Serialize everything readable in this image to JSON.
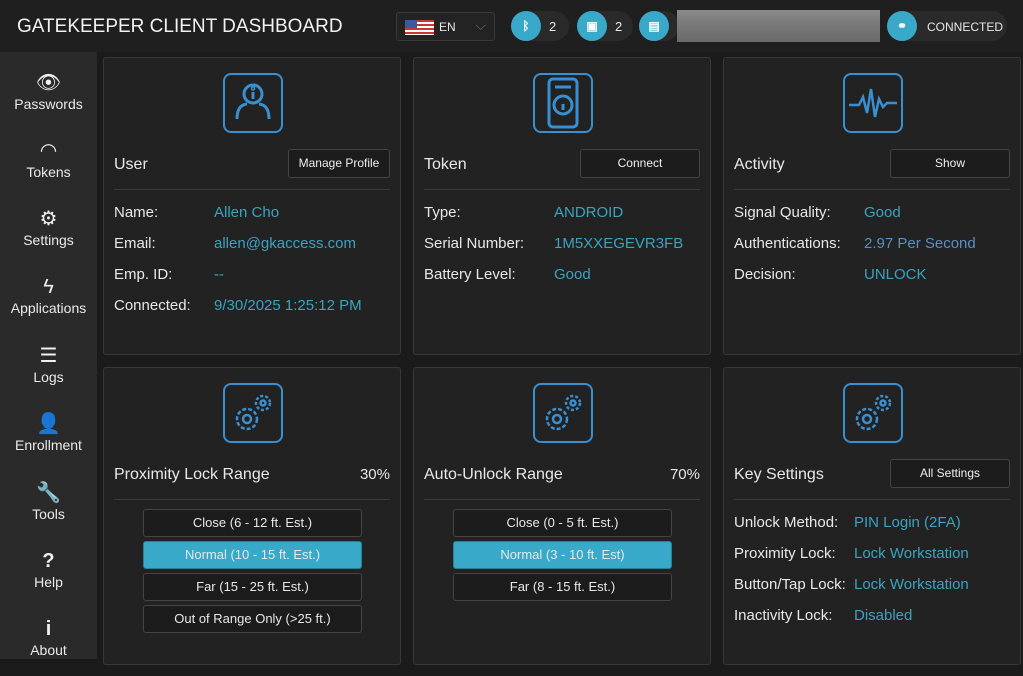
{
  "header": {
    "title": "GATEKEEPER CLIENT DASHBOARD",
    "language": "EN",
    "bluetooth_count": "2",
    "token_count": "2",
    "status": "CONNECTED"
  },
  "sidebar": {
    "items": [
      {
        "label": "Passwords",
        "icon": "eye-icon"
      },
      {
        "label": "Tokens",
        "icon": "wifi-icon"
      },
      {
        "label": "Settings",
        "icon": "gear-icon"
      },
      {
        "label": "Applications",
        "icon": "bolt-icon"
      },
      {
        "label": "Logs",
        "icon": "list-icon"
      },
      {
        "label": "Enrollment",
        "icon": "user-plus-icon"
      },
      {
        "label": "Tools",
        "icon": "wrench-icon"
      },
      {
        "label": "Help",
        "icon": "question-icon"
      },
      {
        "label": "About",
        "icon": "info-icon"
      }
    ]
  },
  "user": {
    "title": "User",
    "button": "Manage Profile",
    "rows": [
      {
        "label": "Name:",
        "value": "Allen Cho"
      },
      {
        "label": "Email:",
        "value": "allen@gkaccess.com"
      },
      {
        "label": "Emp. ID:",
        "value": "--"
      },
      {
        "label": "Connected:",
        "value": "9/30/2025 1:25:12 PM"
      }
    ]
  },
  "token": {
    "title": "Token",
    "button": "Connect",
    "rows": [
      {
        "label": "Type:",
        "value": "ANDROID"
      },
      {
        "label": "Serial Number:",
        "value": "1M5XXEGEVR3FB"
      },
      {
        "label": "Battery Level:",
        "value": "Good"
      }
    ]
  },
  "activity": {
    "title": "Activity",
    "button": "Show",
    "rows": [
      {
        "label": "Signal Quality:",
        "value": "Good"
      },
      {
        "label": "Authentications:",
        "value": "2.97 Per Second"
      },
      {
        "label": "Decision:",
        "value": "UNLOCK"
      }
    ]
  },
  "proximity": {
    "title": "Proximity Lock Range",
    "percent": "30%",
    "options": [
      "Close (6 - 12 ft. Est.)",
      "Normal (10 - 15 ft. Est.)",
      "Far (15 - 25 ft. Est.)",
      "Out of Range Only (>25 ft.)"
    ],
    "selected": 1
  },
  "autounlock": {
    "title": "Auto-Unlock Range",
    "percent": "70%",
    "options": [
      "Close (0 - 5 ft. Est.)",
      "Normal (3 - 10 ft. Est)",
      "Far (8 - 15 ft. Est.)"
    ],
    "selected": 1
  },
  "keysettings": {
    "title": "Key Settings",
    "button": "All Settings",
    "rows": [
      {
        "label": "Unlock Method:",
        "value": "PIN Login (2FA)"
      },
      {
        "label": "Proximity Lock:",
        "value": "Lock Workstation"
      },
      {
        "label": "Button/Tap Lock:",
        "value": "Lock Workstation"
      },
      {
        "label": "Inactivity Lock:",
        "value": "Disabled"
      }
    ]
  },
  "colors": {
    "accent": "#39a9c9",
    "icon": "#3a8fd0",
    "value": "#3ba3bf"
  }
}
